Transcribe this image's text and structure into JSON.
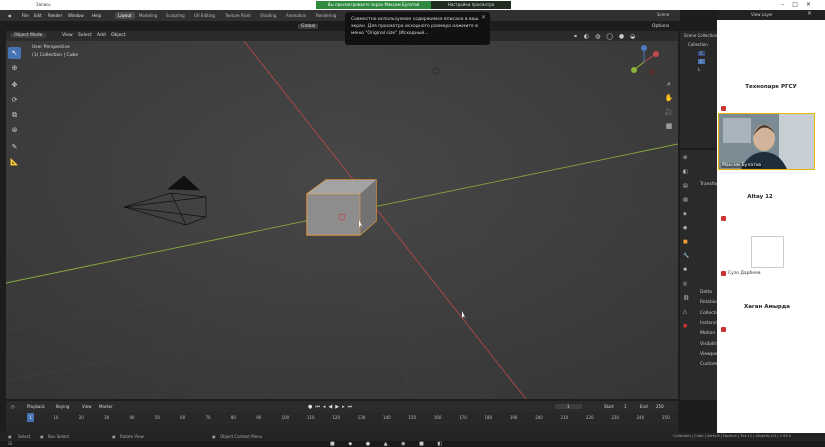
{
  "share": {
    "banner": "Вы просматриваете экран Максим Булатов",
    "settings": "Настройки просмотра",
    "window_title": "Запись"
  },
  "menu": {
    "items": [
      "File",
      "Edit",
      "Render",
      "Window",
      "Help"
    ]
  },
  "workspaces": [
    "Layout",
    "Modeling",
    "Sculpting",
    "UV Editing",
    "Texture Paint",
    "Shading",
    "Animation",
    "Rendering"
  ],
  "view_layer": {
    "scene": "Scene",
    "view_layer": "View Layer"
  },
  "viewport": {
    "mode": "Object Mode",
    "menus": [
      "View",
      "Select",
      "Add",
      "Object"
    ],
    "orientation": "Global",
    "label_perspective": "User Perspective",
    "label_collection": "(1) Collection | Cube",
    "options": "Options"
  },
  "notification": {
    "text": "Совместно используемое содержимое вписано в ваш экран. Для просмотра исходного размера нажмите в меню \"Original size\" (Исходный..."
  },
  "outliner": {
    "items": [
      "Scene Collection",
      "Collection",
      "C",
      "C",
      "L"
    ]
  },
  "properties": {
    "rows": [
      "Transform",
      "Delta",
      "Relations",
      "Collections",
      "Instancing",
      "Motion Paths",
      "Visibility",
      "Viewport Display",
      "Custom Properties"
    ]
  },
  "timeline": {
    "menus": [
      "Playback",
      "Keying",
      "View",
      "Marker"
    ],
    "ticks": [
      "0",
      "10",
      "20",
      "30",
      "40",
      "50",
      "60",
      "70",
      "80",
      "90",
      "100",
      "110",
      "120",
      "130",
      "140",
      "150",
      "160",
      "170",
      "180",
      "190",
      "200",
      "210",
      "220",
      "230",
      "240",
      "250"
    ],
    "current_frame": "1",
    "start_label": "Start",
    "start": "1",
    "end_label": "End",
    "end": "250"
  },
  "statusbar": {
    "select": "Select",
    "box_select": "Box Select",
    "rotate_view": "Rotate View",
    "context_menu": "Object Context Menu",
    "stats": "Collection | Cube | Verts:8 | Faces:6 | Tris:12 | Objects:1/3 | 2.93.0"
  },
  "participants": {
    "tech_park": "Технопарк РГСУ",
    "video_name": "Максим Булатов",
    "altay": "Altay 12",
    "guest": "Сузо Дарбеев",
    "khagan": "Хаган Амырда"
  },
  "colors": {
    "accent": "#4772b3",
    "selection": "#f5a03a",
    "x_axis": "#c24a4a",
    "y_axis": "#8ab43a",
    "share_green": "#2d8a3e"
  }
}
